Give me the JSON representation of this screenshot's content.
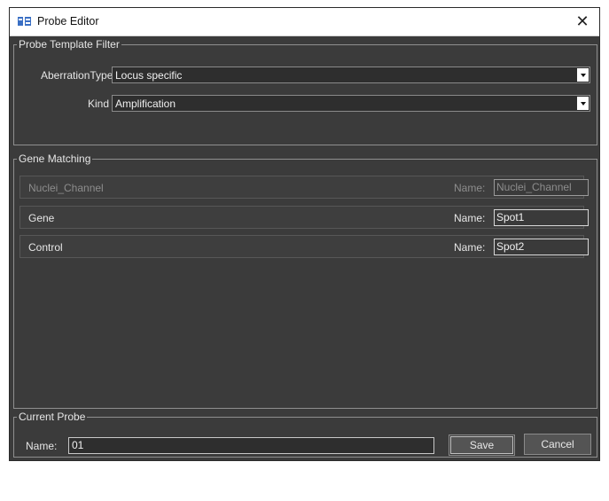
{
  "window": {
    "title": "Probe Editor",
    "close_glyph": "✕",
    "icon": "probe-editor-app-icon"
  },
  "probe_template_filter": {
    "legend": "Probe Template Filter",
    "aberration_type_label": "AberrationType",
    "aberration_type_value": "Locus specific",
    "kind_label": "Kind",
    "kind_value": "Amplification"
  },
  "gene_matching": {
    "legend": "Gene Matching",
    "rows": [
      {
        "label": "Nuclei_Channel",
        "name_label": "Name:",
        "name_value": "Nuclei_Channel",
        "enabled": false
      },
      {
        "label": "Gene",
        "name_label": "Name:",
        "name_value": "Spot1",
        "enabled": true
      },
      {
        "label": "Control",
        "name_label": "Name:",
        "name_value": "Spot2",
        "enabled": true
      }
    ]
  },
  "current_probe": {
    "legend": "Current Probe",
    "name_label": "Name:",
    "name_value": "01",
    "save_label": "Save",
    "cancel_label": "Cancel"
  },
  "colors": {
    "window_bg": "#3b3b3b",
    "titlebar_bg": "#ffffff",
    "text": "#e6e6e6",
    "disabled_text": "#8d8d8d"
  }
}
